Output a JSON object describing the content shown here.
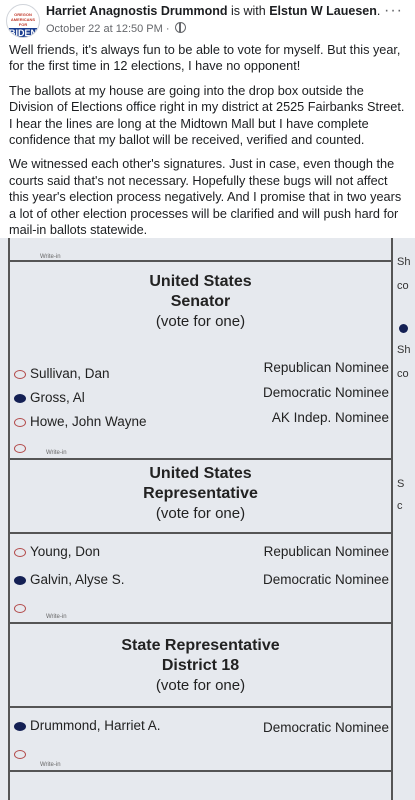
{
  "post": {
    "author": "Harriet Anagnostis Drummond",
    "with_text": " is with ",
    "tagged": "Elstun W Lauesen",
    "period": ".",
    "timestamp": "October 22 at 12:50 PM ·",
    "more": "···",
    "avatar_top": "OREGON AMERICANS FOR",
    "avatar_main": "BIDEN",
    "paragraphs": [
      "Well friends, it's always fun to be able to vote for myself. But this year, for the first time in 12 elections, I have no opponent!",
      "The ballots at my house are going into the drop box outside the Division of Elections office right in my district at 2525 Fairbanks Street. I hear the lines are long at the Midtown Mall but I have complete confidence that my ballot will be received, verified and counted.",
      "We witnessed each other's signatures. Just in case, even though the courts said that's not necessary. Hopefully these bugs will not affect this year's election process negatively. And I promise that in two years a lot of other election processes will be clarified and will push hard for mail-in ballots statewide."
    ]
  },
  "ballot": {
    "write_in_label": "Write-in",
    "senate": {
      "title1": "United States",
      "title2": "Senator",
      "vote": "(vote for one)",
      "candidates": [
        {
          "name": "Sullivan, Dan",
          "party": "Republican Nominee",
          "filled": false
        },
        {
          "name": "Gross, Al",
          "party": "Democratic Nominee",
          "filled": true
        },
        {
          "name": "Howe, John Wayne",
          "party": "AK Indep. Nominee",
          "filled": false
        }
      ]
    },
    "house": {
      "title1": "United States",
      "title2": "Representative",
      "vote": "(vote for one)",
      "candidates": [
        {
          "name": "Young, Don",
          "party": "Republican Nominee",
          "filled": false
        },
        {
          "name": "Galvin, Alyse S.",
          "party": "Democratic Nominee",
          "filled": true
        }
      ]
    },
    "state": {
      "title1": "State Representative",
      "title2": "District 18",
      "vote": "(vote for one)",
      "candidates": [
        {
          "name": "Drummond, Harriet A.",
          "party": "Democratic Nominee",
          "filled": true
        }
      ]
    },
    "right_column": [
      "Sh",
      "co",
      "Sh",
      "co",
      "S",
      "c"
    ]
  }
}
